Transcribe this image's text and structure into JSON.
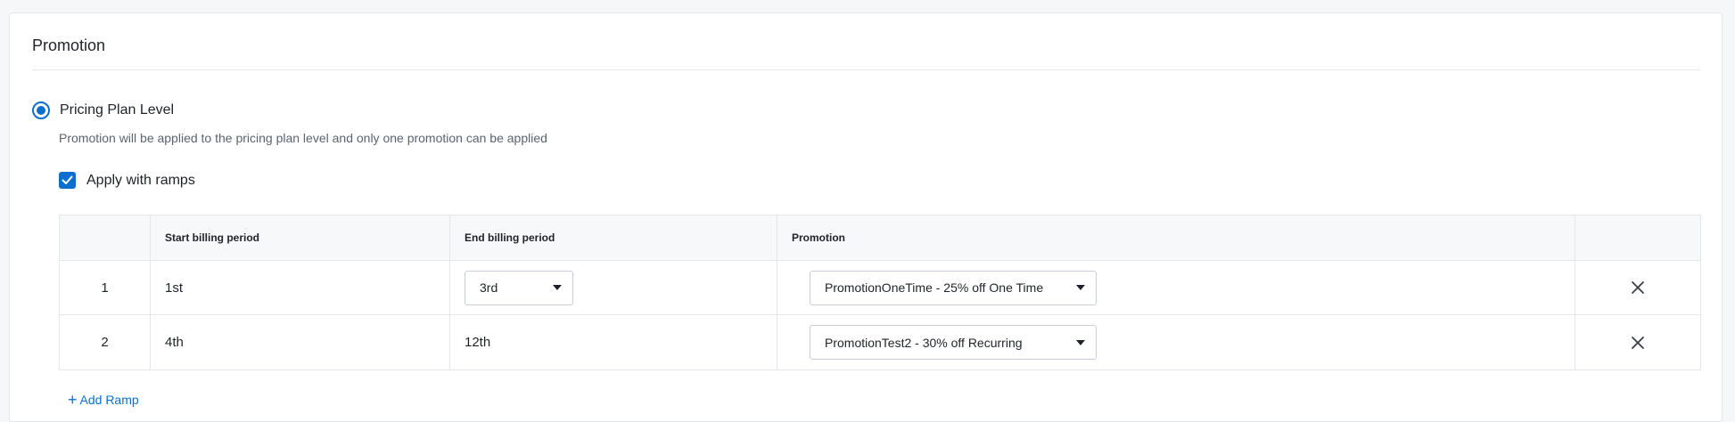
{
  "section": {
    "title": "Promotion"
  },
  "pricing_level": {
    "label": "Pricing Plan Level",
    "description": "Promotion will be applied to the pricing plan level and only one promotion can be applied",
    "selected": true
  },
  "apply_ramps": {
    "label": "Apply with ramps",
    "checked": true
  },
  "table": {
    "headers": [
      "",
      "Start billing period",
      "End billing period",
      "Promotion",
      ""
    ],
    "rows": [
      {
        "index": "1",
        "start": "1st",
        "end": "3rd",
        "end_is_select": true,
        "promotion": "PromotionOneTime - 25% off One Time"
      },
      {
        "index": "2",
        "start": "4th",
        "end": "12th",
        "end_is_select": false,
        "promotion": "PromotionTest2 - 30% off Recurring"
      }
    ]
  },
  "add_ramp": {
    "icon": "plus-icon",
    "label": "Add Ramp"
  },
  "colors": {
    "accent": "#0b6fcf",
    "border": "#e3e6ea",
    "header_bg": "#f7f8fa"
  }
}
